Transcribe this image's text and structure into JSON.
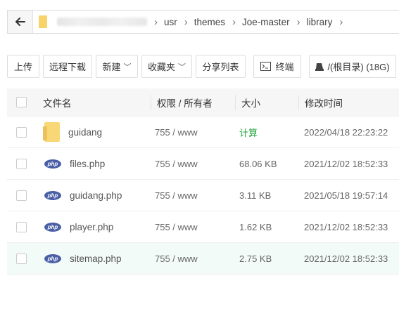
{
  "breadcrumb": {
    "items": [
      "usr",
      "themes",
      "Joe-master",
      "library"
    ]
  },
  "toolbar": {
    "upload": "上传",
    "remote_download": "远程下载",
    "new": "新建",
    "favorites": "收藏夹",
    "share_list": "分享列表",
    "terminal": "终端",
    "disk": "/(根目录) (18G)"
  },
  "table": {
    "headers": {
      "name": "文件名",
      "perm": "权限 / 所有者",
      "size": "大小",
      "mtime": "修改时间"
    },
    "rows": [
      {
        "type": "folder",
        "name": "guidang",
        "perm": "755 / www",
        "size": "计算",
        "mtime": "2022/04/18 22:23:22"
      },
      {
        "type": "php",
        "name": "files.php",
        "perm": "755 / www",
        "size": "68.06 KB",
        "mtime": "2021/12/02 18:52:33"
      },
      {
        "type": "php",
        "name": "guidang.php",
        "perm": "755 / www",
        "size": "3.11 KB",
        "mtime": "2021/05/18 19:57:14"
      },
      {
        "type": "php",
        "name": "player.php",
        "perm": "755 / www",
        "size": "1.62 KB",
        "mtime": "2021/12/02 18:52:33"
      },
      {
        "type": "php",
        "name": "sitemap.php",
        "perm": "755 / www",
        "size": "2.75 KB",
        "mtime": "2021/12/02 18:52:33"
      }
    ],
    "php_icon_text": "php"
  },
  "colors": {
    "accent_green": "#20a53a",
    "php_icon": "#4a5fa6",
    "folder": "#f8d777",
    "highlight_row": "#f3fbf8"
  }
}
